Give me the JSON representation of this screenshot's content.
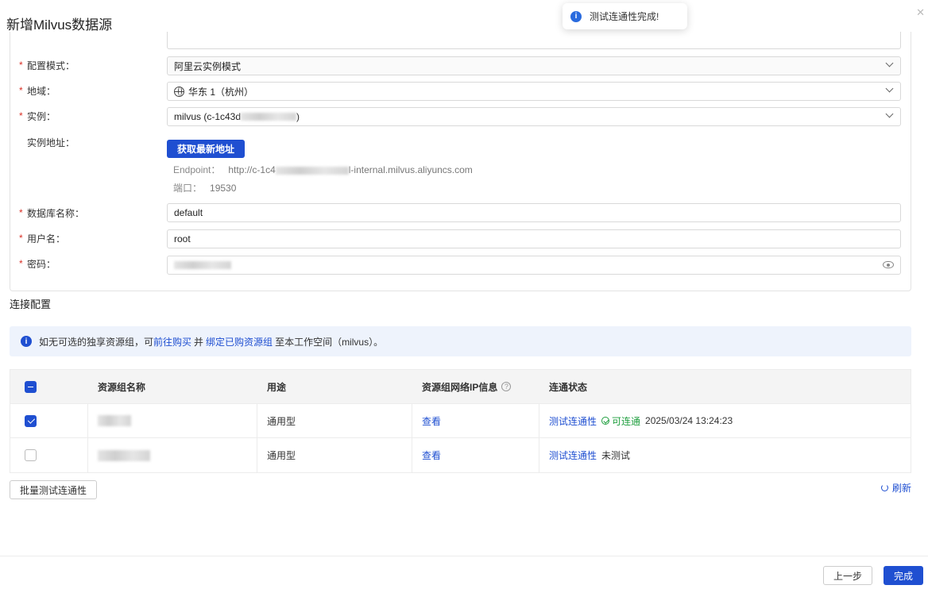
{
  "dialog": {
    "title": "新增Milvus数据源"
  },
  "toast": {
    "message": "测试连通性完成!"
  },
  "form": {
    "config_mode": {
      "label": "配置模式：",
      "value": "阿里云实例模式"
    },
    "region": {
      "label": "地域：",
      "value": "华东 1（杭州）"
    },
    "instance": {
      "label": "实例：",
      "value_prefix": "milvus (c-1c43d",
      "value_suffix": ")"
    },
    "instance_address": {
      "label": "实例地址：",
      "fetch_button": "获取最新地址",
      "endpoint_label": "Endpoint：",
      "endpoint_prefix": "http://c-1c4",
      "endpoint_suffix": "l-internal.milvus.aliyuncs.com",
      "port_label": "端口：",
      "port_value": "19530"
    },
    "database": {
      "label": "数据库名称：",
      "value": "default"
    },
    "username": {
      "label": "用户名：",
      "value": "root"
    },
    "password": {
      "label": "密码："
    }
  },
  "connection": {
    "section_title": "连接配置",
    "alert": {
      "text_before": "如无可选的独享资源组，可",
      "link_buy": "前往购买",
      "text_and": "并",
      "link_bind": "绑定已购资源组",
      "text_after": "至本工作空间（milvus）。"
    },
    "table": {
      "headers": [
        "资源组名称",
        "用途",
        "资源组网络IP信息",
        "连通状态"
      ],
      "rows": [
        {
          "usage": "通用型",
          "view": "查看",
          "test_link": "测试连通性",
          "status": "可连通",
          "time": "2025/03/24 13:24:23",
          "checked": true
        },
        {
          "usage": "通用型",
          "view": "查看",
          "test_link": "测试连通性",
          "status": "未测试",
          "checked": false
        }
      ]
    },
    "batch_test_button": "批量测试连通性",
    "refresh_label": "刷新"
  },
  "footer": {
    "prev_button": "上一步",
    "done_button": "完成"
  }
}
